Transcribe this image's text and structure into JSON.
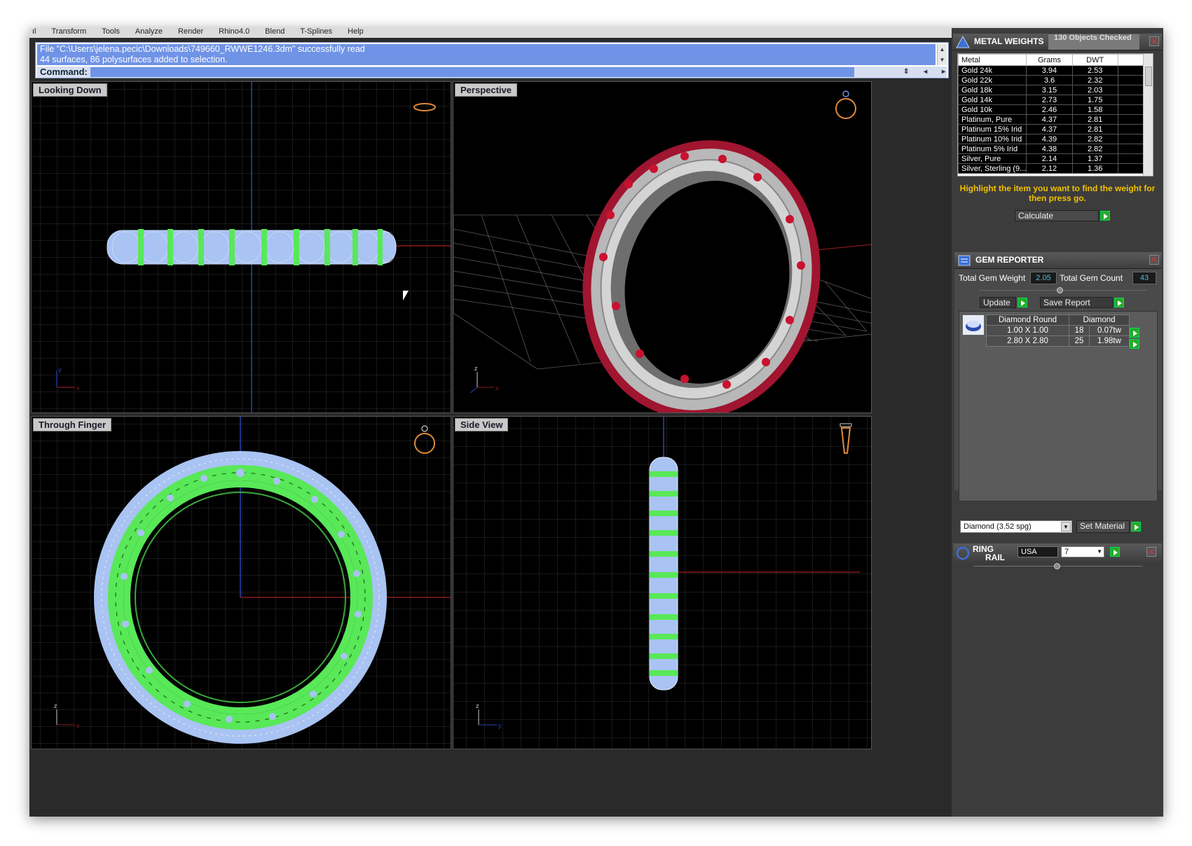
{
  "menubar": [
    "ıl",
    "Transform",
    "Tools",
    "Analyze",
    "Render",
    "Rhino4.0",
    "Blend",
    "T-Splines",
    "Help"
  ],
  "command": {
    "history_line1": "File \"C:\\Users\\jelena.pecic\\Downloads\\749660_RWWE1246.3dm\" successfully read",
    "history_line2": "44 surfaces, 86 polysurfaces added to selection.",
    "prompt_label": "Command:"
  },
  "viewports": {
    "top_left": "Looking Down",
    "top_right": "Perspective",
    "bottom_left": "Through Finger",
    "bottom_right": "Side View"
  },
  "metal_weights": {
    "title": "METAL WEIGHTS",
    "status": "130 Objects Checked",
    "columns": [
      "Metal",
      "Grams",
      "DWT"
    ],
    "rows": [
      [
        "Gold 24k",
        "3.94",
        "2.53"
      ],
      [
        "Gold 22k",
        "3.6",
        "2.32"
      ],
      [
        "Gold 18k",
        "3.15",
        "2.03"
      ],
      [
        "Gold 14k",
        "2.73",
        "1.75"
      ],
      [
        "Gold 10k",
        "2.46",
        "1.58"
      ],
      [
        "Platinum, Pure",
        "4.37",
        "2.81"
      ],
      [
        "Platinum 15% Irid",
        "4.37",
        "2.81"
      ],
      [
        "Platinum 10% Irid",
        "4.39",
        "2.82"
      ],
      [
        "Platinum 5% Irid",
        "4.38",
        "2.82"
      ],
      [
        "Silver, Pure",
        "2.14",
        "1.37"
      ],
      [
        "Silver, Sterling (9...",
        "2.12",
        "1.36"
      ]
    ],
    "hint": "Highlight the item you want to find the weight for then press go.",
    "calculate_label": "Calculate"
  },
  "gem_reporter": {
    "title": "GEM REPORTER",
    "total_weight_label": "Total Gem Weight",
    "total_weight_value": "2.05",
    "total_count_label": "Total Gem Count",
    "total_count_value": "43",
    "update_label": "Update",
    "save_label": "Save Report",
    "table_header": [
      "Diamond Round",
      "Diamond"
    ],
    "rows": [
      [
        "1.00 X 1.00",
        "18",
        "0.07tw"
      ],
      [
        "2.80 X 2.80",
        "25",
        "1.98tw"
      ]
    ],
    "material_select": "Diamond    (3.52 spg)",
    "set_material_label": "Set Material"
  },
  "ring_rail": {
    "title_line1": "RING",
    "title_line2": "RAIL",
    "country": "USA",
    "size": "7"
  },
  "colors": {
    "grid": "#2c2c2c",
    "ring_green": "#58e858",
    "gem_blue": "#a9c3f2",
    "metal_silver": "#c9c9c9",
    "ruby": "#a01530",
    "command_blue": "#6f93e6",
    "hint_yellow": "#f2c200"
  }
}
